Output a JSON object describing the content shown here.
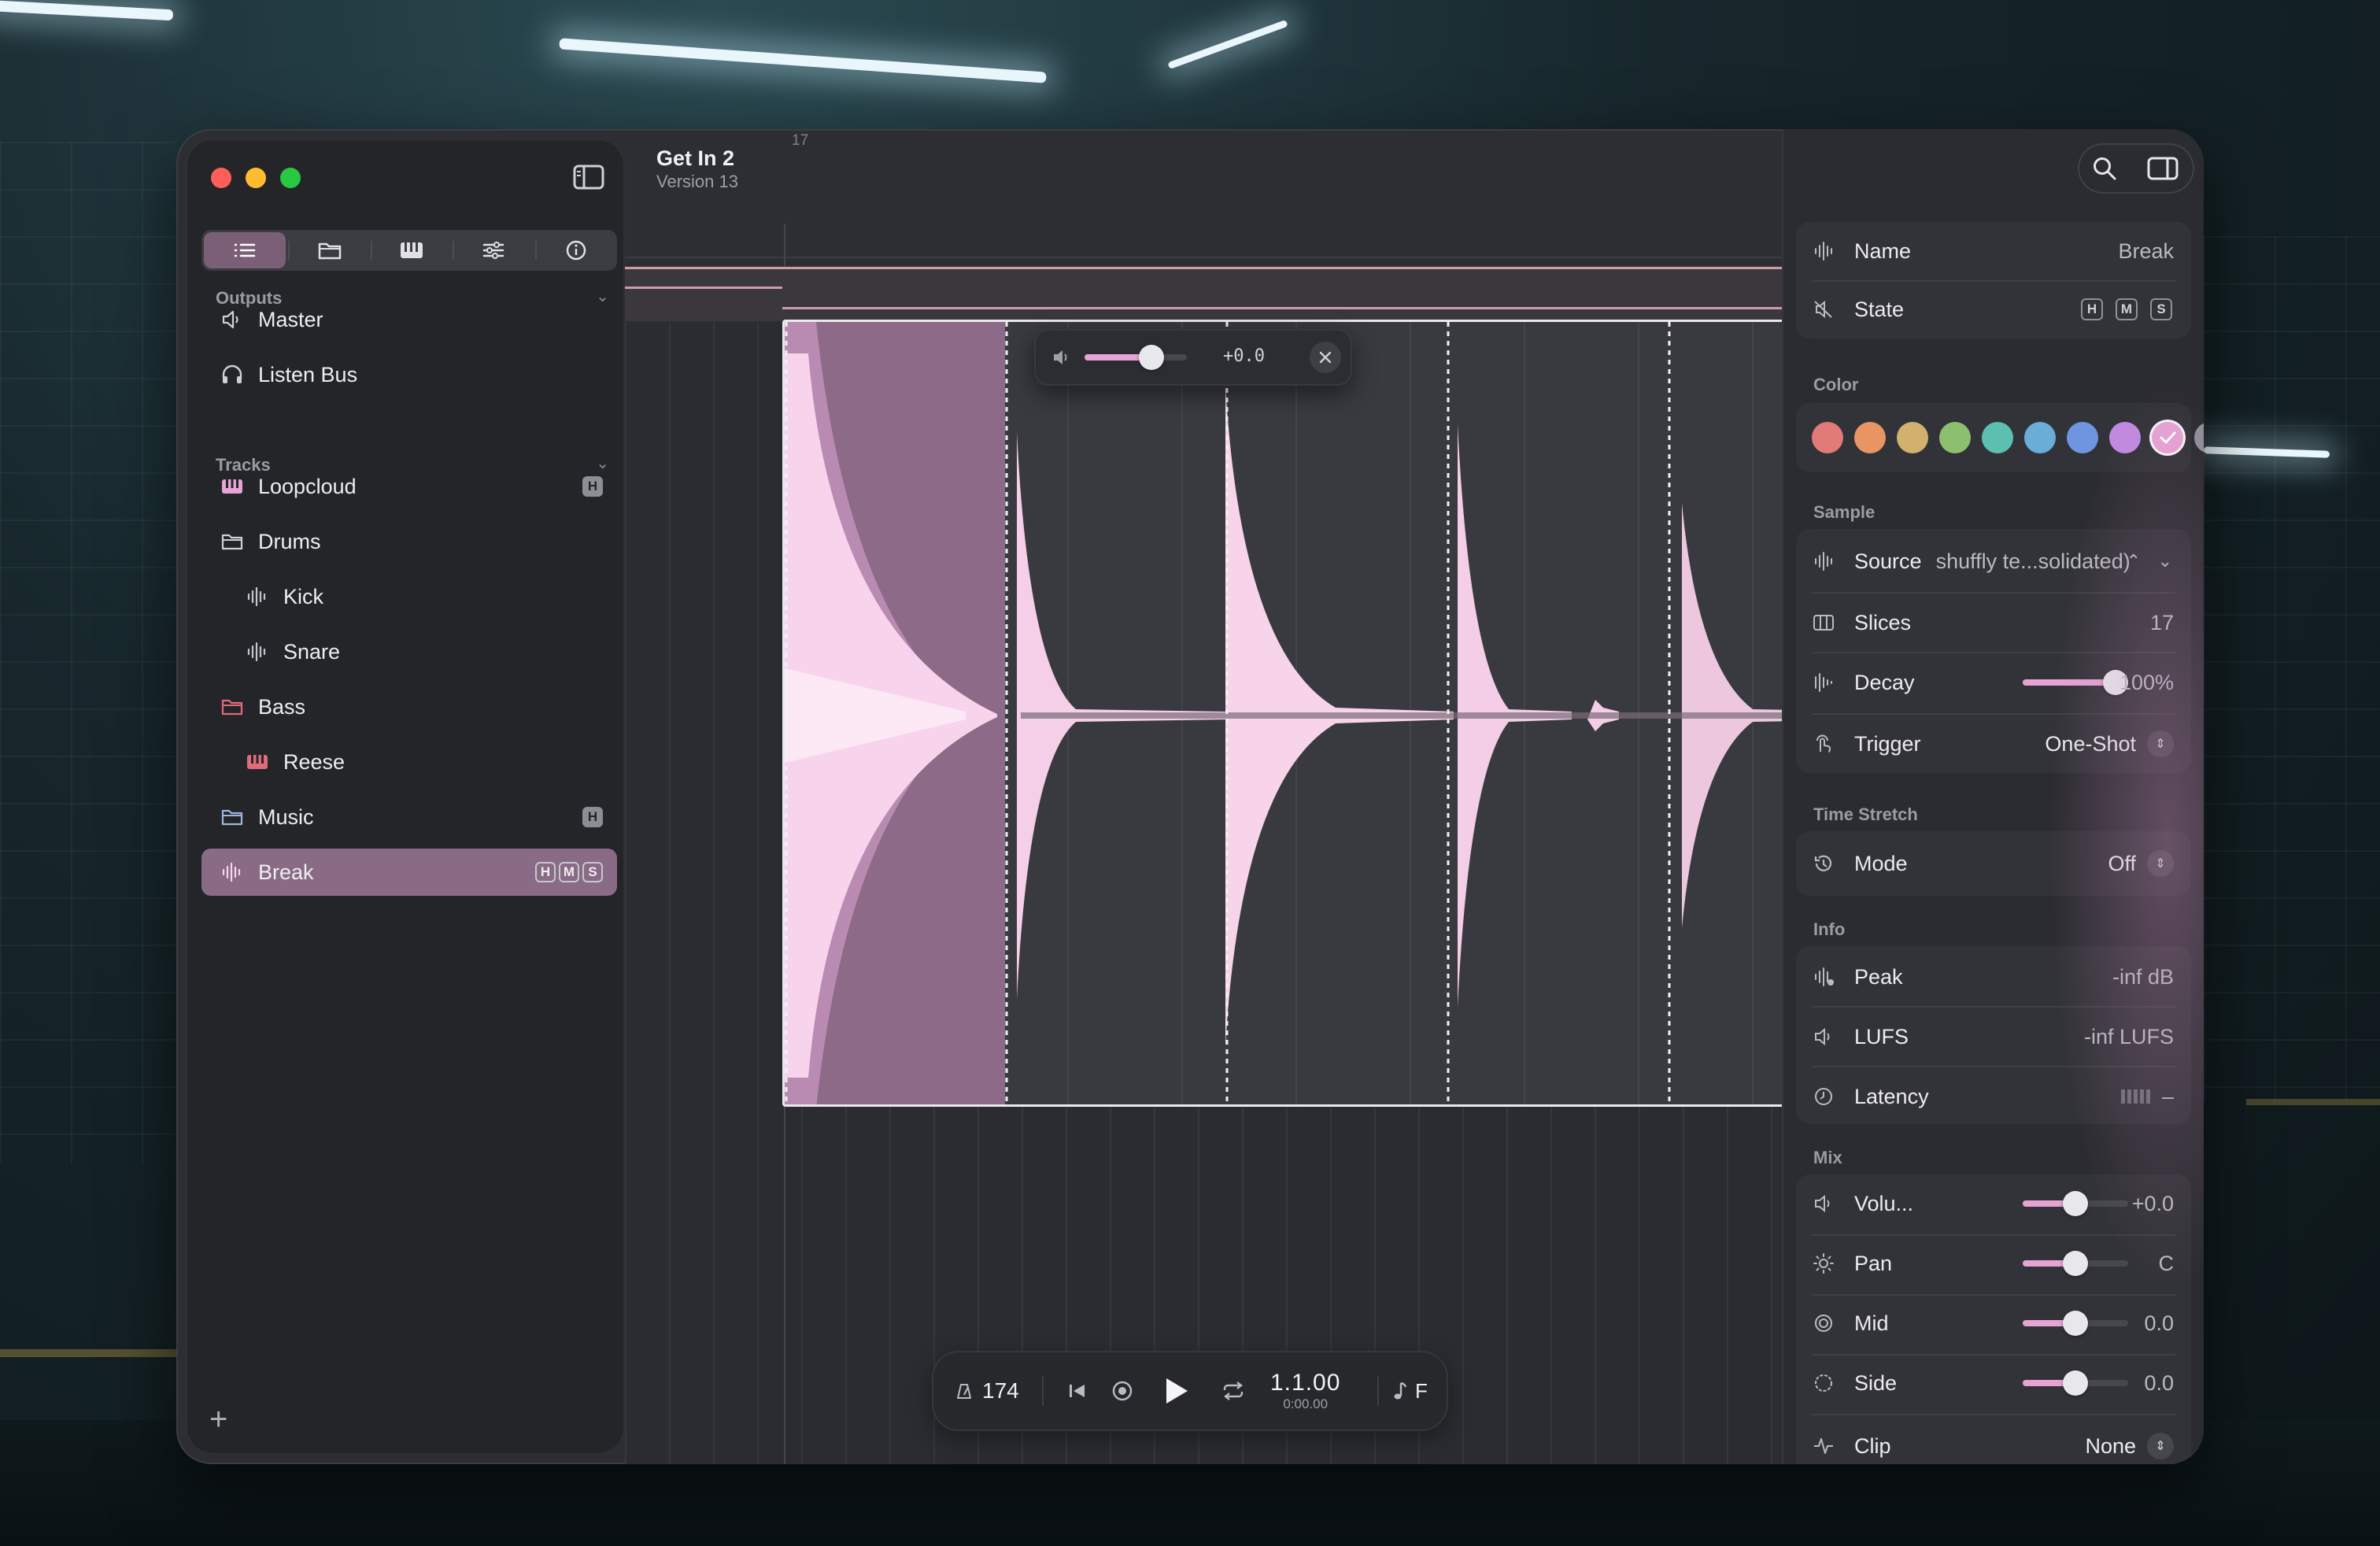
{
  "window": {
    "title": "Get In 2",
    "subtitle": "Version 13"
  },
  "sidebar": {
    "tabs": [
      {
        "icon": "list-icon",
        "active": true
      },
      {
        "icon": "folder-icon",
        "active": false
      },
      {
        "icon": "piano-icon",
        "active": false
      },
      {
        "icon": "sliders-icon",
        "active": false
      },
      {
        "icon": "info-icon",
        "active": false
      }
    ],
    "outputs_label": "Outputs",
    "outputs": [
      {
        "label": "Master",
        "icon": "speaker-icon"
      },
      {
        "label": "Listen Bus",
        "icon": "headphones-icon"
      }
    ],
    "tracks_label": "Tracks",
    "tracks": [
      {
        "label": "Loopcloud",
        "icon": "piano-icon",
        "badge": "H"
      },
      {
        "label": "Drums",
        "icon": "folder-icon"
      },
      {
        "label": "Kick",
        "icon": "waveform-icon"
      },
      {
        "label": "Snare",
        "icon": "waveform-icon"
      },
      {
        "label": "Bass",
        "icon": "folder-icon"
      },
      {
        "label": "Reese",
        "icon": "piano-icon"
      },
      {
        "label": "Music",
        "icon": "folder-icon",
        "badge": "H"
      },
      {
        "label": "Break",
        "icon": "waveform-icon",
        "badges": [
          "H",
          "M",
          "S"
        ]
      }
    ],
    "add_label": "+"
  },
  "ruler": {
    "bar": "17"
  },
  "volume_popover": {
    "value": "+0.0",
    "level": 0.65
  },
  "transport": {
    "tempo": "174",
    "position": "1.1.00",
    "time": "0:00.00",
    "key": "F"
  },
  "inspector": {
    "name_label": "Name",
    "name_value": "Break",
    "state_label": "State",
    "state_buttons": [
      "H",
      "M",
      "S"
    ],
    "color_label": "Color",
    "colors": [
      "#e07b78",
      "#e89563",
      "#d2b06e",
      "#8cbf6e",
      "#5cbfb0",
      "#6aaed8",
      "#6f94e0",
      "#c18ae0",
      "#e6a3d3",
      "#8d8f98"
    ],
    "sample_label": "Sample",
    "source_label": "Source",
    "source_value": "shuffly te...solidated)",
    "slices_label": "Slices",
    "slices_value": "17",
    "decay_label": "Decay",
    "decay_value": "100%",
    "decay_level": 1.0,
    "trigger_label": "Trigger",
    "trigger_value": "One-Shot",
    "time_stretch_label": "Time Stretch",
    "mode_label": "Mode",
    "mode_value": "Off",
    "info_label": "Info",
    "peak_label": "Peak",
    "peak_value": "-inf dB",
    "lufs_label": "LUFS",
    "lufs_value": "-inf LUFS",
    "latency_label": "Latency",
    "latency_value": "–",
    "mix_label": "Mix",
    "volume_label": "Volu...",
    "volume_value": "+0.0",
    "volume_level": 0.5,
    "pan_label": "Pan",
    "pan_value": "C",
    "pan_level": 0.5,
    "mid_label": "Mid",
    "mid_value": "0.0",
    "mid_level": 0.5,
    "side_label": "Side",
    "side_value": "0.0",
    "side_level": 0.5,
    "clip_label": "Clip",
    "clip_value": "None"
  },
  "colors": {
    "accent": "#e6a3d3",
    "selection": "#8a6b85"
  }
}
